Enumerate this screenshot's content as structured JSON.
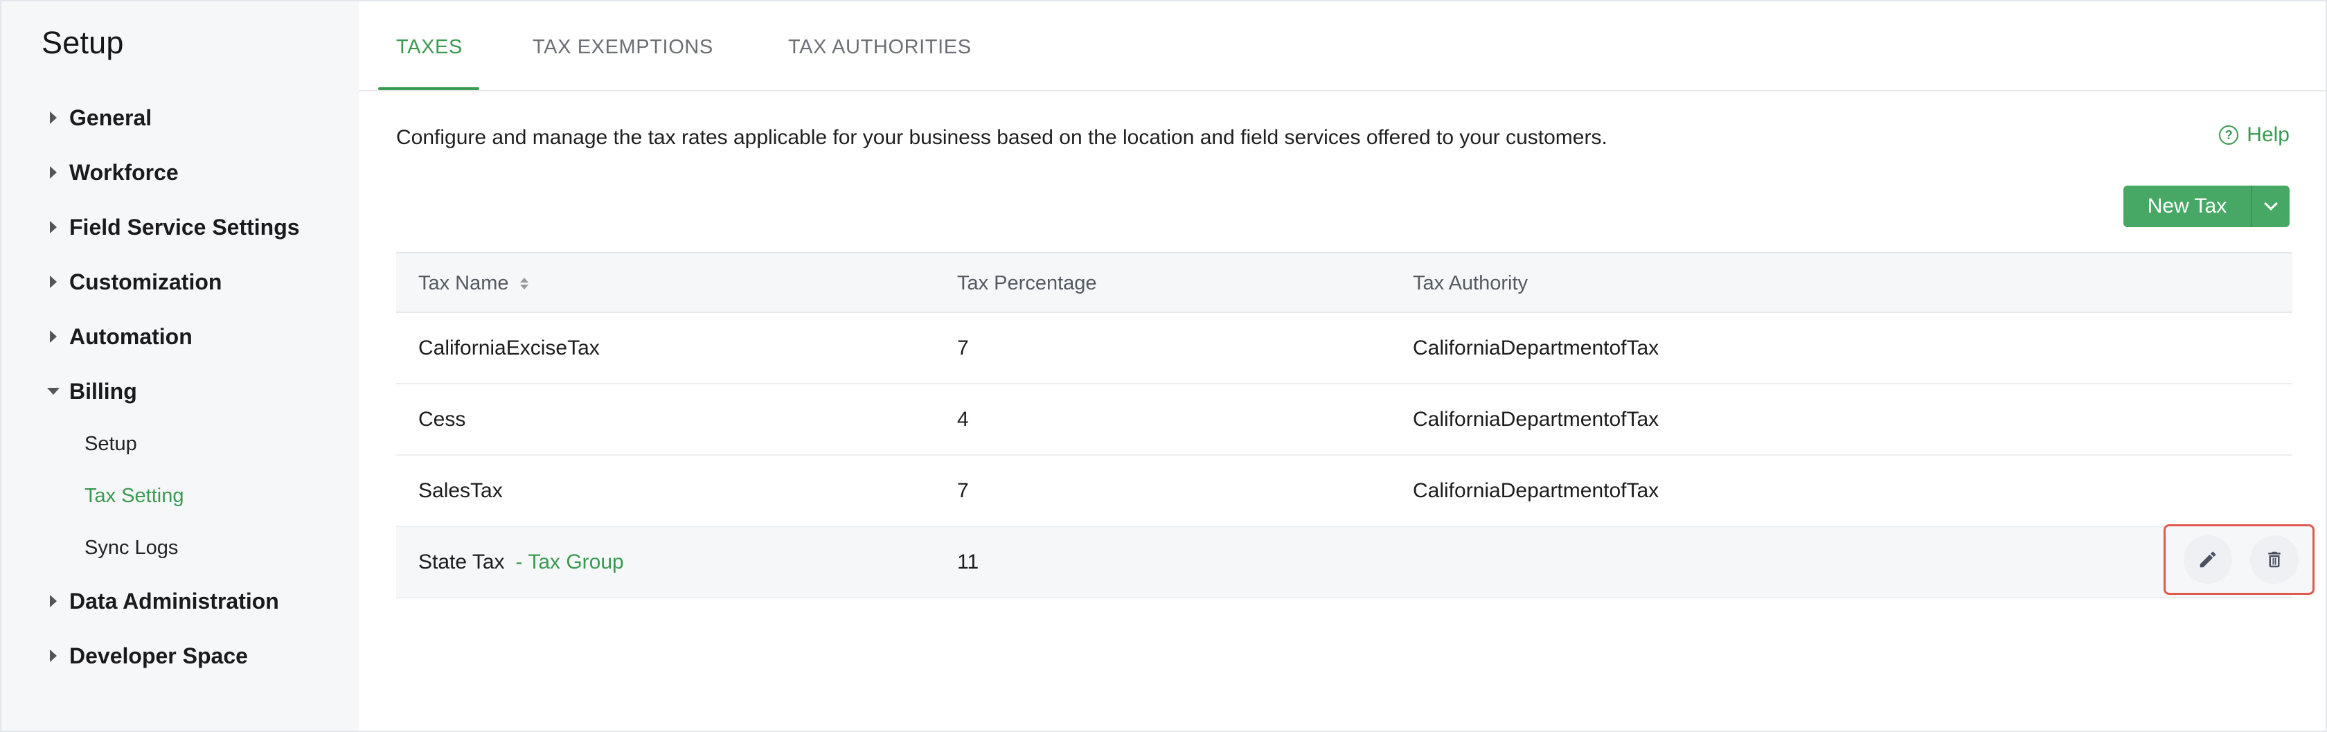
{
  "sidebar": {
    "title": "Setup",
    "items": [
      {
        "label": "General",
        "expanded": false
      },
      {
        "label": "Workforce",
        "expanded": false
      },
      {
        "label": "Field Service Settings",
        "expanded": false
      },
      {
        "label": "Customization",
        "expanded": false
      },
      {
        "label": "Automation",
        "expanded": false
      },
      {
        "label": "Billing",
        "expanded": true
      },
      {
        "label": "Data Administration",
        "expanded": false
      },
      {
        "label": "Developer Space",
        "expanded": false
      }
    ],
    "billing_subitems": [
      {
        "label": "Setup",
        "active": false
      },
      {
        "label": "Tax Setting",
        "active": true
      },
      {
        "label": "Sync Logs",
        "active": false
      }
    ]
  },
  "tabs": [
    {
      "label": "TAXES",
      "active": true
    },
    {
      "label": "TAX EXEMPTIONS",
      "active": false
    },
    {
      "label": "TAX AUTHORITIES",
      "active": false
    }
  ],
  "description": "Configure and manage the tax rates applicable for your business based on the location and field services offered to your customers.",
  "help_label": "Help",
  "new_tax_label": "New Tax",
  "table": {
    "columns": [
      "Tax Name",
      "Tax Percentage",
      "Tax Authority"
    ],
    "rows": [
      {
        "name": "CaliforniaExciseTax",
        "tag": "",
        "percentage": "7",
        "authority": "CaliforniaDepartmentofTax"
      },
      {
        "name": "Cess",
        "tag": "",
        "percentage": "4",
        "authority": "CaliforniaDepartmentofTax"
      },
      {
        "name": "SalesTax",
        "tag": "",
        "percentage": "7",
        "authority": "CaliforniaDepartmentofTax"
      },
      {
        "name": "State Tax",
        "tag": "- Tax Group",
        "percentage": "11",
        "authority": ""
      }
    ]
  },
  "colors": {
    "accent": "#3a9a4f",
    "button": "#47a865",
    "highlight": "#e05a4f"
  },
  "icons": {
    "edit": "pencil-icon",
    "delete": "trash-icon",
    "help": "help-circle-icon"
  }
}
